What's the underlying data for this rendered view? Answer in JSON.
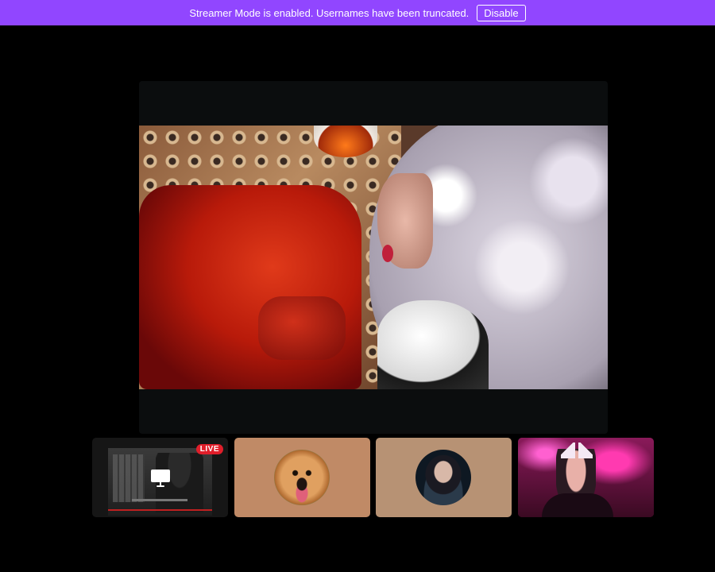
{
  "banner": {
    "message": "Streamer Mode is enabled. Usernames have been truncated.",
    "disable_label": "Disable",
    "color": "#9146ff"
  },
  "stage": {
    "main_video": "red-chair-curly-wig-video"
  },
  "thumbnails": [
    {
      "type": "screen-share",
      "badge": "LIVE",
      "badge_color": "#e01e2a",
      "icon": "monitor-icon"
    },
    {
      "type": "avatar",
      "avatar": "golden-retriever-avatar",
      "bg_color": "#c08a66"
    },
    {
      "type": "avatar",
      "avatar": "dark-haired-woman-avatar",
      "bg_color": "#b79274"
    },
    {
      "type": "camera",
      "avatar": "cat-ear-headphones-camera",
      "bg_color": "#5a1030"
    }
  ]
}
